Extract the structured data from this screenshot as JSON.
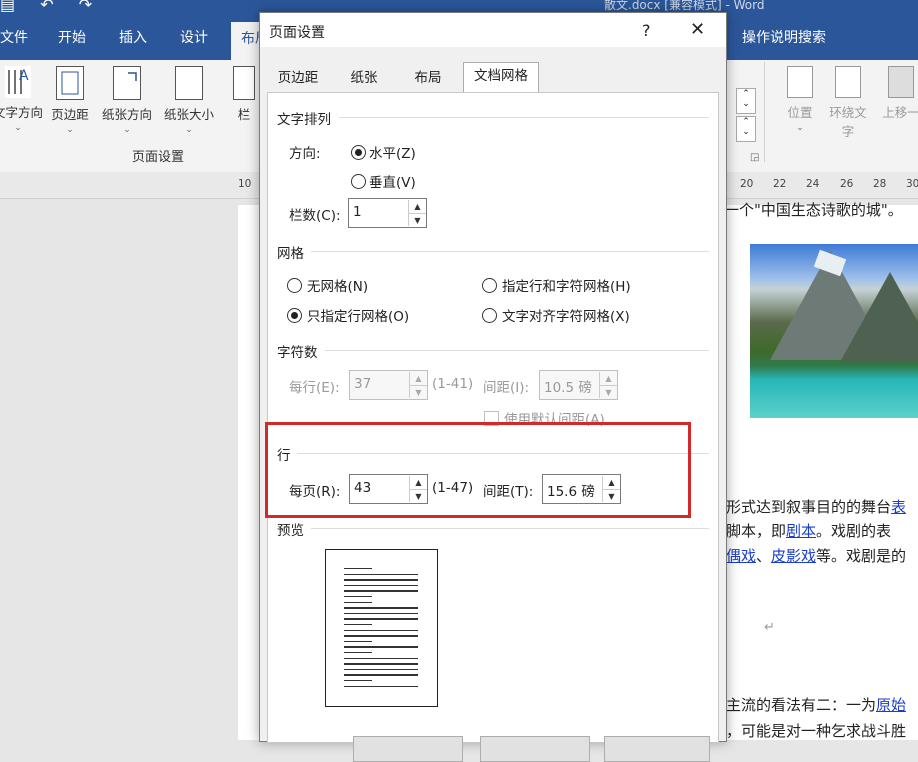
{
  "window": {
    "title": "散文.docx [兼容模式] - Word"
  },
  "ribbon_tabs": [
    "文件",
    "开始",
    "插入",
    "设计",
    "布局"
  ],
  "search_label": "操作说明搜索",
  "ribbon": {
    "buttons": [
      "文字方向",
      "页边距",
      "纸张方向",
      "纸张大小",
      "栏"
    ],
    "group_label": "页面设置",
    "right_buttons": [
      "位置",
      "环绕文字",
      "上移一"
    ]
  },
  "ruler": {
    "left_mark": "10",
    "ticks": [
      "20",
      "22",
      "24",
      "26",
      "28",
      "30"
    ]
  },
  "document": {
    "line_top": "一个\"中国生态诗歌的城\"。",
    "para1_a": "形式达到叙事目的的舞台",
    "para1_a_link": "表",
    "para2_a": "脚本，即",
    "para2_link": "剧本",
    "para2_b": "。戏剧的表",
    "para3_link1": "偶戏",
    "para3_sep": "、",
    "para3_link2": "皮影戏",
    "para3_b": "等。戏剧是的",
    "return_mark": "↵",
    "para4_a": "主流的看法有二：一为",
    "para4_link": "原始",
    "para5": "，可能是对一种乞求战斗胜"
  },
  "dialog": {
    "title": "页面设置",
    "help": "?",
    "close": "✕",
    "tabs": [
      "页边距",
      "纸张",
      "布局",
      "文档网格"
    ],
    "active_tab": "文档网格",
    "text_direction": {
      "section": "文字排列",
      "direction_label": "方向:",
      "horizontal": "水平(Z)",
      "vertical": "垂直(V)",
      "columns_label": "栏数(C):",
      "columns_value": "1"
    },
    "grid": {
      "section": "网格",
      "no_grid": "无网格(N)",
      "line_char_grid": "指定行和字符网格(H)",
      "line_grid_only": "只指定行网格(O)",
      "snap_to_chars": "文字对齐字符网格(X)",
      "selected": "只指定行网格(O)"
    },
    "characters": {
      "section": "字符数",
      "per_line_label": "每行(E):",
      "per_line_value": "37",
      "per_line_range": "(1-41)",
      "pitch_label": "间距(I):",
      "pitch_value": "10.5 磅",
      "default_pitch": "使用默认间距(A)"
    },
    "lines": {
      "section": "行",
      "per_page_label": "每页(R):",
      "per_page_value": "43",
      "per_page_range": "(1-47)",
      "pitch_label": "间距(T):",
      "pitch_value": "15.6 磅"
    },
    "preview": {
      "section": "预览"
    }
  },
  "colors": {
    "word_blue": "#2b579a",
    "highlight_red": "#d12a2a",
    "link_blue": "#1a3ecc"
  }
}
